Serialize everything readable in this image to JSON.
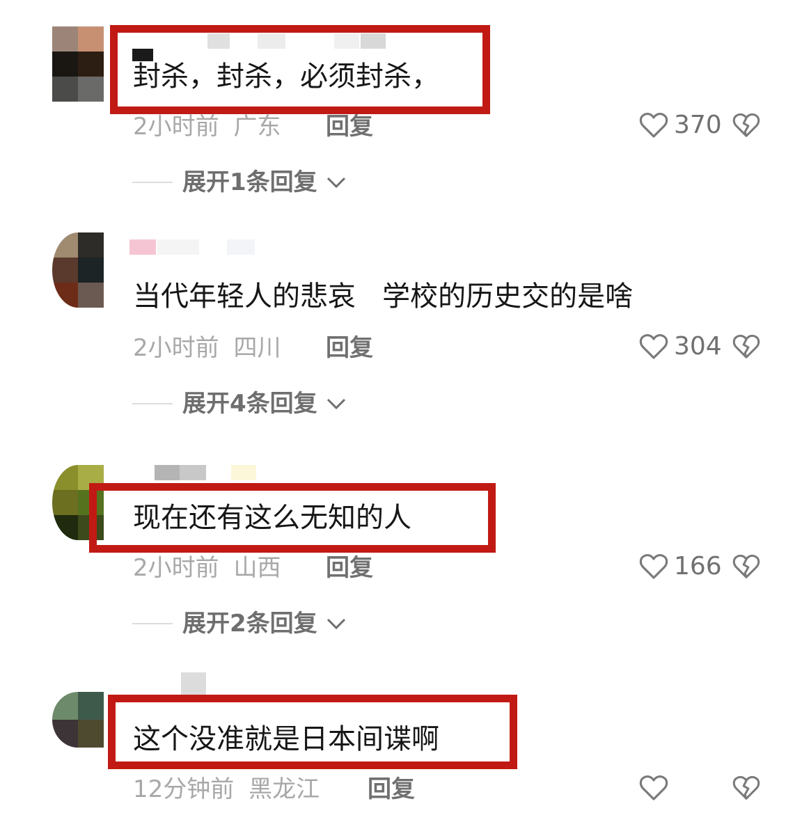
{
  "comments": [
    {
      "text": "封杀，封杀，必须封杀，",
      "time": "2小时前",
      "location": "广东",
      "reply_label": "回复",
      "likes": "370",
      "expand_label": "展开1条回复",
      "highlighted": true
    },
    {
      "text": "当代年轻人的悲哀   学校的历史交的是啥",
      "time": "2小时前",
      "location": "四川",
      "reply_label": "回复",
      "likes": "304",
      "expand_label": "展开4条回复",
      "highlighted": false
    },
    {
      "text": "现在还有这么无知的人",
      "time": "2小时前",
      "location": "山西",
      "reply_label": "回复",
      "likes": "166",
      "expand_label": "展开2条回复",
      "highlighted": true
    },
    {
      "text": "这个没准就是日本间谍啊",
      "time": "12分钟前",
      "location": "黑龙江",
      "reply_label": "回复",
      "likes": "",
      "highlighted": true
    }
  ],
  "colors": {
    "highlight_border": "#c11a14",
    "comment_text": "#161616",
    "meta_text": "#a8a8a8",
    "secondary_text": "#707070"
  },
  "icons": {
    "like": "heart-outline-icon",
    "dislike": "broken-heart-icon",
    "expand": "chevron-down-icon"
  }
}
